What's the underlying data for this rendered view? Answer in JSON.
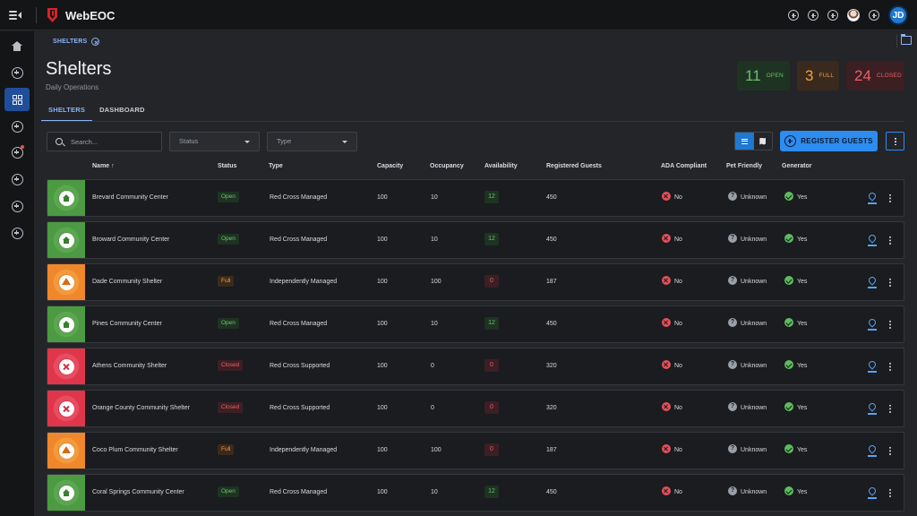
{
  "app": {
    "title": "WebEOC",
    "user_initials": "JD"
  },
  "breadcrumb": {
    "label": "SHELTERS"
  },
  "page": {
    "title": "Shelters",
    "subtitle": "Daily Operations"
  },
  "stats": [
    {
      "value": "11",
      "label": "OPEN",
      "color": "#66c26b"
    },
    {
      "value": "3",
      "label": "FULL",
      "color": "#f3a043"
    },
    {
      "value": "24",
      "label": "CLOSED",
      "color": "#ee5f63"
    }
  ],
  "tabs": [
    {
      "label": "SHELTERS",
      "active": true
    },
    {
      "label": "DASHBOARD",
      "active": false
    }
  ],
  "filters": {
    "search_placeholder": "Search...",
    "status_placeholder": "Status",
    "type_placeholder": "Type"
  },
  "actions": {
    "register_label": "REGISTER GUESTS"
  },
  "columns": {
    "name": "Name",
    "status": "Status",
    "type": "Type",
    "capacity": "Capacity",
    "occupancy": "Occupancy",
    "availability": "Availability",
    "registered": "Registered Guests",
    "ada": "ADA Compliant",
    "pet": "Pet Friendly",
    "generator": "Generator"
  },
  "rows": [
    {
      "name": "Brevard Community Center",
      "status": "Open",
      "status_key": "open",
      "type": "Red Cross Managed",
      "capacity": "100",
      "occupancy": "10",
      "availability": "12",
      "registered": "450",
      "ada": "No",
      "pet": "Unknown",
      "generator": "Yes"
    },
    {
      "name": "Broward Community Center",
      "status": "Open",
      "status_key": "open",
      "type": "Red Cross Managed",
      "capacity": "100",
      "occupancy": "10",
      "availability": "12",
      "registered": "450",
      "ada": "No",
      "pet": "Unknown",
      "generator": "Yes"
    },
    {
      "name": "Dade Community Shelter",
      "status": "Full",
      "status_key": "full",
      "type": "Independently Managed",
      "capacity": "100",
      "occupancy": "100",
      "availability": "0",
      "registered": "187",
      "ada": "No",
      "pet": "Unknown",
      "generator": "Yes"
    },
    {
      "name": "Pines Community Center",
      "status": "Open",
      "status_key": "open",
      "type": "Red Cross Managed",
      "capacity": "100",
      "occupancy": "10",
      "availability": "12",
      "registered": "450",
      "ada": "No",
      "pet": "Unknown",
      "generator": "Yes"
    },
    {
      "name": "Athens Community Shelter",
      "status": "Closed",
      "status_key": "closed",
      "type": "Red Cross Supported",
      "capacity": "100",
      "occupancy": "0",
      "availability": "0",
      "registered": "320",
      "ada": "No",
      "pet": "Unknown",
      "generator": "Yes"
    },
    {
      "name": "Orange County Community Shelter",
      "status": "Closed",
      "status_key": "closed",
      "type": "Red Cross Supported",
      "capacity": "100",
      "occupancy": "0",
      "availability": "0",
      "registered": "320",
      "ada": "No",
      "pet": "Unknown",
      "generator": "Yes"
    },
    {
      "name": "Coco Plum Community Shelter",
      "status": "Full",
      "status_key": "full",
      "type": "Independently Managed",
      "capacity": "100",
      "occupancy": "100",
      "availability": "0",
      "registered": "187",
      "ada": "No",
      "pet": "Unknown",
      "generator": "Yes"
    },
    {
      "name": "Coral Springs Community Center",
      "status": "Open",
      "status_key": "open",
      "type": "Red Cross Managed",
      "capacity": "100",
      "occupancy": "10",
      "availability": "12",
      "registered": "450",
      "ada": "No",
      "pet": "Unknown",
      "generator": "Yes"
    }
  ]
}
